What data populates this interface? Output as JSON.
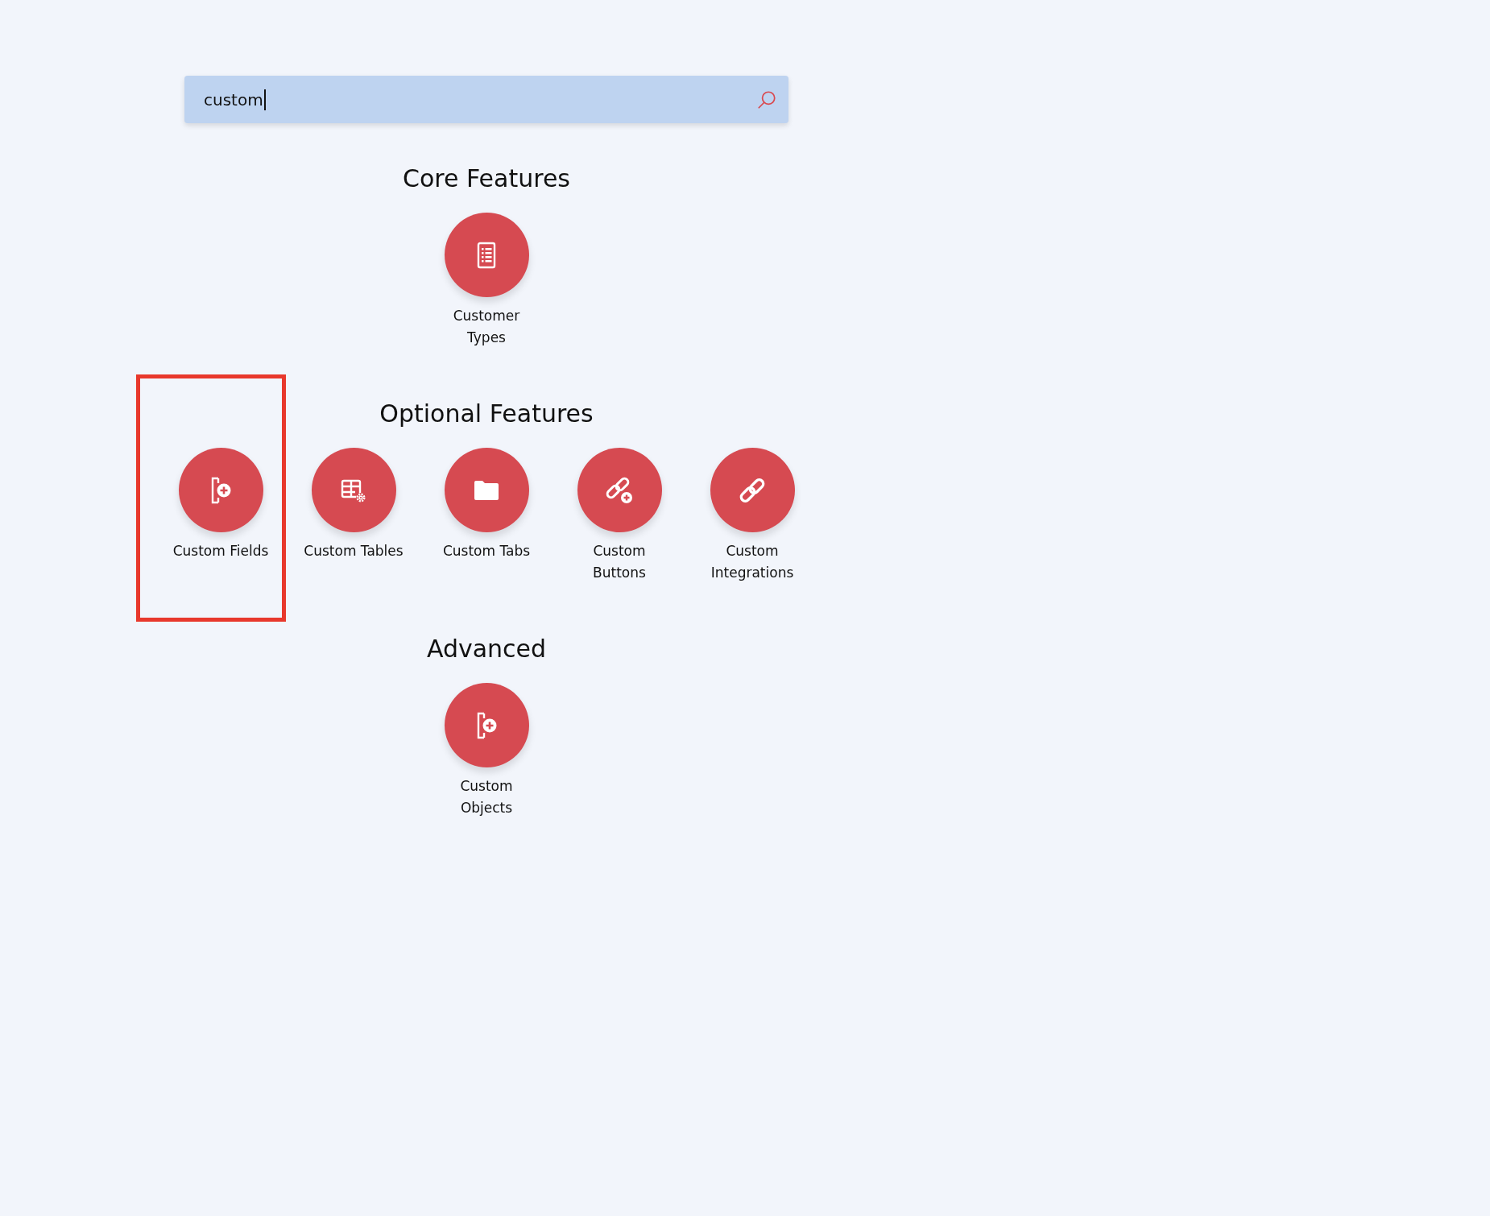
{
  "search": {
    "value": "custom",
    "focused": true
  },
  "sections": [
    {
      "title": "Core Features",
      "items": [
        {
          "label": "Customer Types",
          "kind": "list",
          "highlighted": false
        }
      ]
    },
    {
      "title": "Optional Features",
      "items": [
        {
          "label": "Custom Fields",
          "kind": "field-add",
          "highlighted": true
        },
        {
          "label": "Custom Tables",
          "kind": "table-gear",
          "highlighted": false
        },
        {
          "label": "Custom Tabs",
          "kind": "folder",
          "highlighted": false
        },
        {
          "label": "Custom Buttons",
          "kind": "link-add",
          "highlighted": false
        },
        {
          "label": "Custom Integrations",
          "kind": "link",
          "highlighted": false
        }
      ]
    },
    {
      "title": "Advanced",
      "items": [
        {
          "label": "Custom Objects",
          "kind": "field-add",
          "highlighted": false
        }
      ]
    }
  ]
}
